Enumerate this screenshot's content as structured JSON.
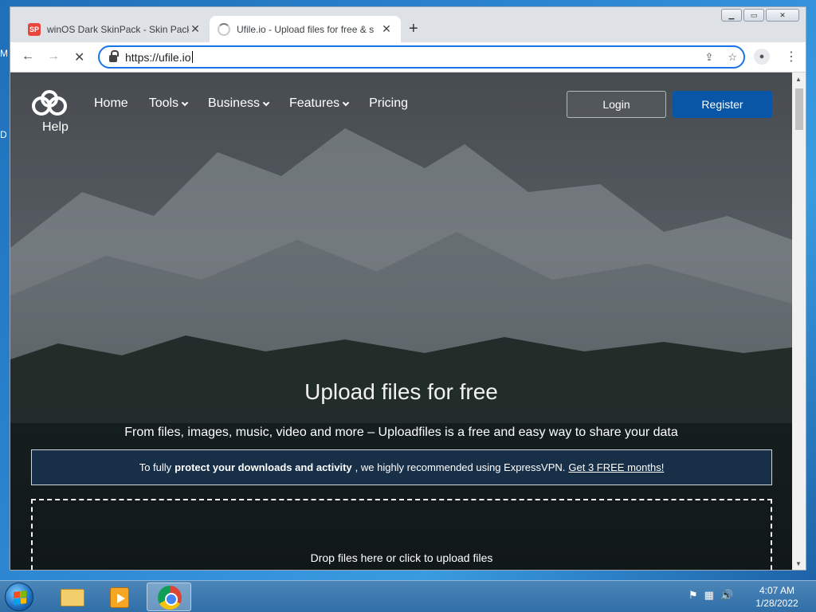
{
  "desktop": {
    "edge_labels": [
      "M",
      "D"
    ]
  },
  "window": {
    "controls": [
      "minimize",
      "maximize",
      "close"
    ],
    "tabs": [
      {
        "title": "winOS Dark SkinPack - Skin Pack",
        "favicon": "SP"
      },
      {
        "title": "Ufile.io - Upload files for free & s",
        "favicon": "loading-spinner"
      }
    ]
  },
  "toolbar": {
    "url": "https://ufile.io"
  },
  "site": {
    "brand_label": "Help",
    "nav": [
      "Home",
      "Tools",
      "Business",
      "Features",
      "Pricing"
    ],
    "login_label": "Login",
    "register_label": "Register",
    "hero_title": "Upload files for free",
    "hero_subtitle": "From files, images, music, video and more – Uploadfiles is a free and easy way to share your data",
    "vpn_banner": {
      "prefix": "To fully",
      "bold": "protect your downloads and activity",
      "middle": ", we highly recommended using ExpressVPN.",
      "link": "Get 3 FREE months!"
    },
    "dropzone_text": "Drop files here or click to upload files"
  },
  "taskbar": {
    "clock_time": "4:07 AM",
    "clock_date": "1/28/2022"
  },
  "colors": {
    "register": "#0a56a6",
    "omnibox_focus": "#1a73e8",
    "taskbar": "#3a78b0"
  }
}
